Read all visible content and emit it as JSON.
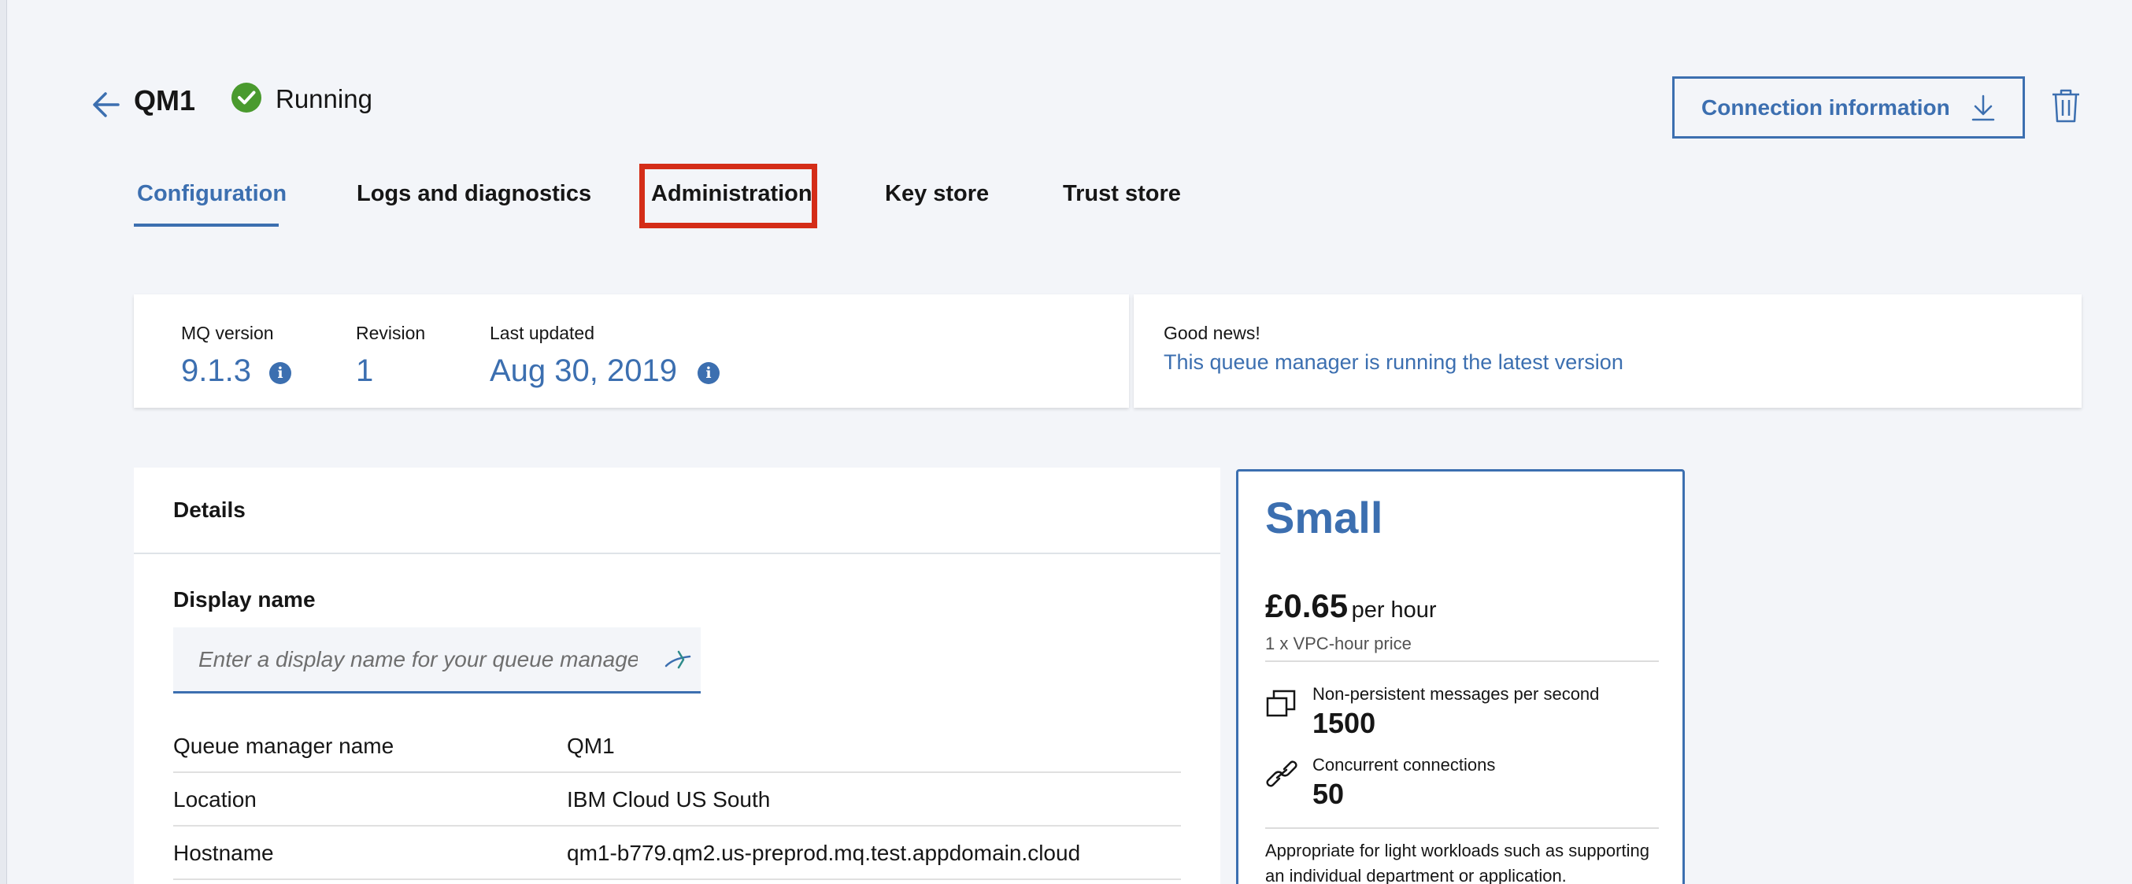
{
  "header": {
    "title": "QM1",
    "status": "Running",
    "connection_button": "Connection information"
  },
  "tabs": [
    {
      "label": "Configuration",
      "active": true
    },
    {
      "label": "Logs and diagnostics",
      "active": false
    },
    {
      "label": "Administration",
      "active": false
    },
    {
      "label": "Key store",
      "active": false
    },
    {
      "label": "Trust store",
      "active": false
    }
  ],
  "version": {
    "mq_version_label": "MQ version",
    "mq_version": "9.1.3",
    "revision_label": "Revision",
    "revision": "1",
    "last_updated_label": "Last updated",
    "last_updated": "Aug 30, 2019"
  },
  "news": {
    "title": "Good news!",
    "message": "This queue manager is running the latest version"
  },
  "details": {
    "title": "Details",
    "display_name_label": "Display name",
    "display_name_placeholder": "Enter a display name for your queue manager",
    "display_name_value": "",
    "rows": [
      {
        "key": "Queue manager name",
        "value": "QM1"
      },
      {
        "key": "Location",
        "value": "IBM Cloud US South"
      },
      {
        "key": "Hostname",
        "value": "qm1-b779.qm2.us-preprod.mq.test.appdomain.cloud"
      }
    ]
  },
  "plan": {
    "name": "Small",
    "price": "£0.65",
    "price_unit": "per hour",
    "price_note": "1 x VPC-hour price",
    "features": [
      {
        "label": "Non-persistent messages per second",
        "value": "1500",
        "icon": "messages-icon"
      },
      {
        "label": "Concurrent connections",
        "value": "50",
        "icon": "link-icon"
      }
    ],
    "description": "Appropriate for light workloads such as supporting an individual department or application."
  },
  "colors": {
    "accent": "#3c6fb0",
    "status_green": "#4a9a2e",
    "highlight": "#d42d18",
    "background": "#f3f5f9"
  }
}
